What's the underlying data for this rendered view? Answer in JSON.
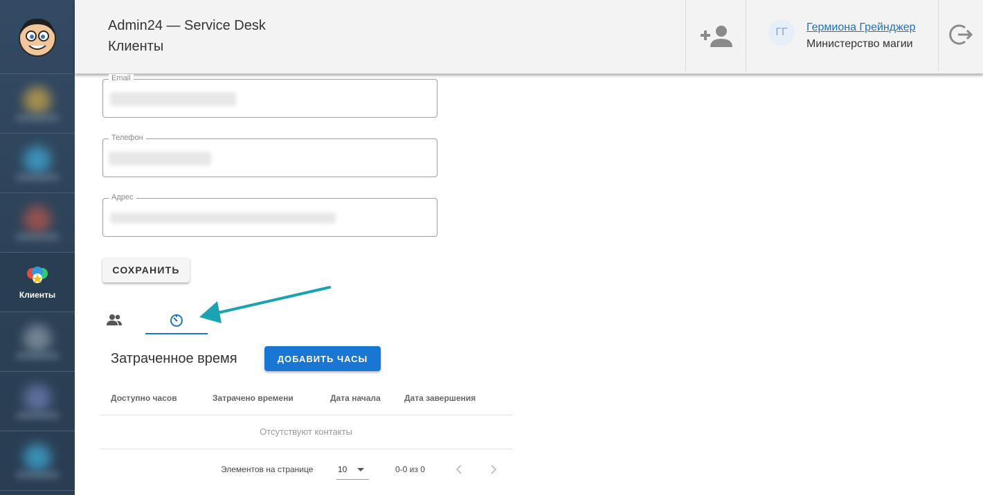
{
  "header": {
    "app_title": "Admin24 — Service Desk",
    "page_title": "Клиенты",
    "user": {
      "initials": "ГГ",
      "name": "Гермиона Грейнджер",
      "organization": "Министерство магии"
    }
  },
  "sidebar": {
    "active_item": {
      "label": "Клиенты",
      "icon": "clients-icon"
    }
  },
  "form": {
    "email_label": "Email",
    "phone_label": "Телефон",
    "address_label": "Адрес",
    "save_label": "СОХРАНИТЬ"
  },
  "tabs": [
    {
      "icon": "people-icon",
      "active": false
    },
    {
      "icon": "timer-icon",
      "active": true
    }
  ],
  "time_section": {
    "title": "Затраченное время",
    "add_button_label": "ДОБАВИТЬ ЧАСЫ",
    "columns": [
      "Доступно часов",
      "Затрачено времени",
      "Дата начала",
      "Дата завершения"
    ],
    "empty_message": "Отсутствуют контакты"
  },
  "pagination": {
    "items_per_page_label": "Элементов на странице",
    "page_size": "10",
    "range": "0-0 из 0"
  },
  "colors": {
    "sidebar_bg": "#2c4156",
    "primary": "#1976d2",
    "annotation_arrow": "#1aa3b3"
  }
}
